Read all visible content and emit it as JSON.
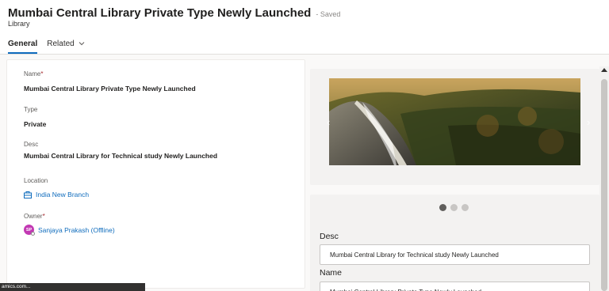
{
  "header": {
    "title": "Mumbai Central Library Private Type  Newly Launched",
    "saved_status": "- Saved",
    "entity_type": "Library"
  },
  "tabs": [
    {
      "label": "General",
      "active": true
    },
    {
      "label": "Related",
      "active": false
    }
  ],
  "form": {
    "name": {
      "label": "Name",
      "required": "*",
      "value": "Mumbai Central Library Private Type  Newly Launched"
    },
    "type": {
      "label": "Type",
      "value": "Private"
    },
    "desc": {
      "label": "Desc",
      "value": "Mumbai Central Library for Technical study Newly Launched"
    },
    "location": {
      "label": "Location",
      "value": "India New Branch",
      "icon": "building-icon"
    },
    "owner": {
      "label": "Owner",
      "required": "*",
      "value": "Sanjaya Prakash (Offline)",
      "initials": "SP"
    }
  },
  "carousel": {
    "prev_glyph": "‹",
    "next_glyph": "›",
    "image": "waterfall-forest-landscape"
  },
  "details": {
    "desc_label": "Desc",
    "desc_value": "Mumbai Central Library for Technical study Newly Launched",
    "name_label": "Name",
    "name_value": "Mumbai Central Library Private Type  Newly Launched"
  },
  "statusbar": {
    "text": "amics.com..."
  },
  "colors": {
    "accent": "#0f6cbd",
    "avatar": "#c239b3",
    "required": "#a4262c"
  }
}
